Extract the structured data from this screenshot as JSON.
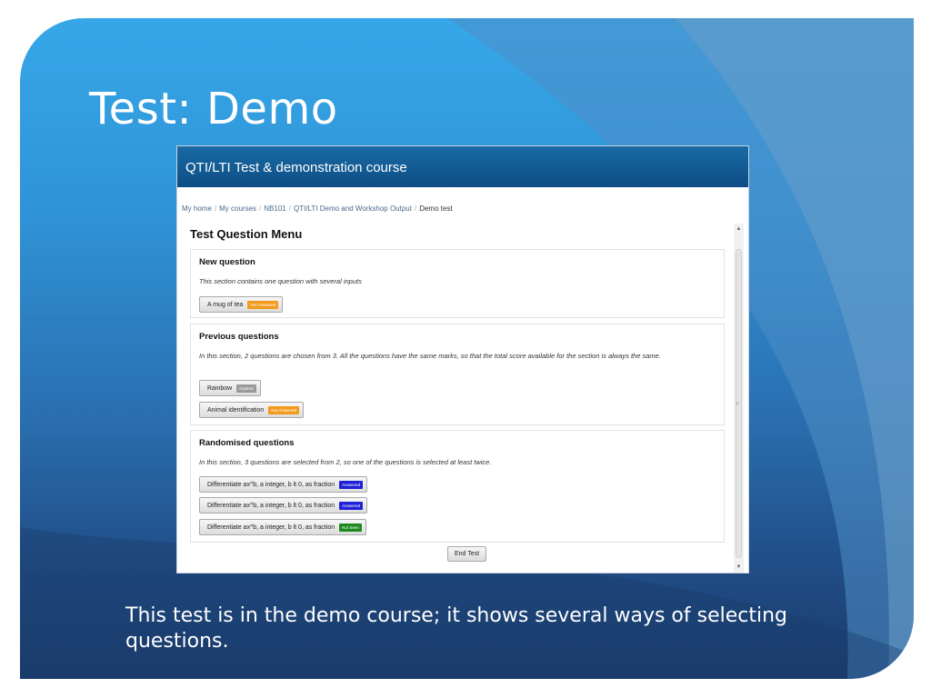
{
  "slide": {
    "title": "Test: Demo",
    "caption": "This test is in the demo course; it shows several ways of selecting questions."
  },
  "course": {
    "header_title": "QTI/LTI Test & demonstration course",
    "breadcrumb": [
      "My home",
      "My courses",
      "NB101",
      "QTI/LTI Demo and Workshop Output",
      "Demo test"
    ]
  },
  "menu": {
    "title": "Test Question Menu",
    "sections": [
      {
        "heading": "New question",
        "description": "This section contains one question with several inputs",
        "questions": [
          {
            "label": "A mug of tea",
            "status": "Not Answered"
          }
        ]
      },
      {
        "heading": "Previous questions",
        "description": "In this section, 2 questions are chosen from 3. All the questions have the same marks, so that the total score available for the section is always the same.",
        "questions": [
          {
            "label": "Rainbow",
            "status": "Expired"
          },
          {
            "label": "Animal identification",
            "status": "Not Answered"
          }
        ]
      },
      {
        "heading": "Randomised questions",
        "description": "In this section, 3 questions are selected from 2, so one of the questions is selected at least twice.",
        "questions": [
          {
            "label": "Differentiate ax^b, a integer, b lt 0, as fraction",
            "status": "Answered"
          },
          {
            "label": "Differentiate ax^b, a integer, b lt 0, as fraction",
            "status": "Answered"
          },
          {
            "label": "Differentiate ax^b, a integer, b lt 0, as fraction",
            "status": "Not Seen"
          }
        ]
      }
    ],
    "end_button": "End Test"
  },
  "status_colors": {
    "not_answered": "#f29a1d",
    "expired": "#9a9a9a",
    "answered": "#2020d8",
    "not_seen": "#1e8a1e"
  },
  "icons": {
    "scroll_up": "scroll-up-arrow-icon",
    "scroll_down": "scroll-down-arrow-icon",
    "scroll_grip": "scroll-grip-icon"
  }
}
